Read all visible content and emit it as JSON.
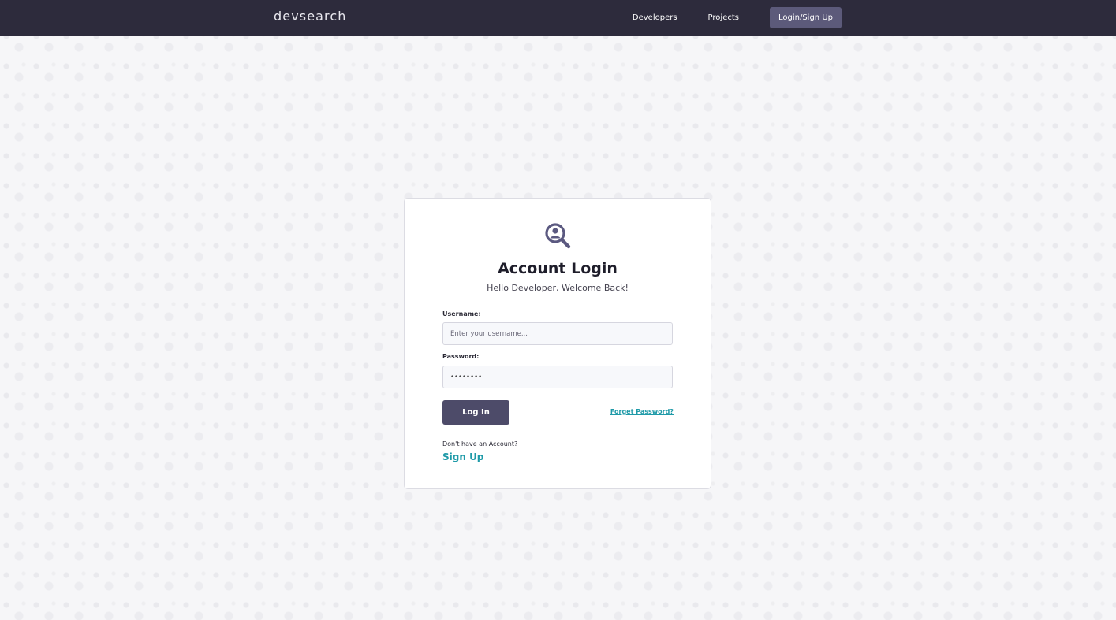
{
  "header": {
    "logo_text": "devsearch",
    "nav": {
      "developers": "Developers",
      "projects": "Projects",
      "login_signup": "Login/Sign Up"
    }
  },
  "card": {
    "icon": "search-user-icon",
    "title": "Account Login",
    "subtitle": "Hello Developer, Welcome Back!",
    "username": {
      "label": "Username:",
      "placeholder": "Enter your username...",
      "value": ""
    },
    "password": {
      "label": "Password:",
      "value": "••••••••"
    },
    "login_button": "Log In",
    "forgot_password": "Forget Password?",
    "no_account_text": "Don't have an Account?",
    "signup_link": "Sign Up"
  },
  "colors": {
    "navbar_bg": "#2d2b3c",
    "accent": "#4d4b69",
    "link": "#1f9aa8",
    "icon": "#5b5980"
  }
}
